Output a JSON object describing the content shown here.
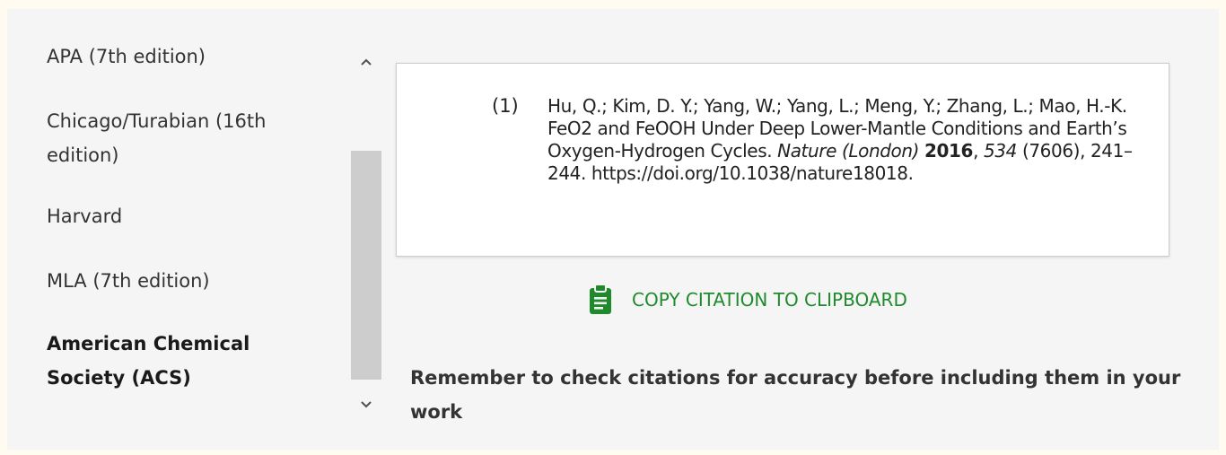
{
  "styles": {
    "items": [
      {
        "label": "APA (7th edition)",
        "selected": false
      },
      {
        "label": "Chicago/Turabian (16th edition)",
        "selected": false
      },
      {
        "label": "Harvard",
        "selected": false
      },
      {
        "label": "MLA (7th edition)",
        "selected": false
      },
      {
        "label": "American Chemical Society (ACS)",
        "selected": true
      }
    ]
  },
  "citation": {
    "number": "(1)",
    "authors": "Hu, Q.; Kim, D. Y.; Yang, W.; Yang, L.; Meng, Y.; Zhang, L.; Mao, H.-K.",
    "title": "FeO2 and FeOOH Under Deep Lower-Mantle Conditions and Earth’s Oxygen-Hydrogen Cycles.",
    "journal": "Nature (London)",
    "year": "2016",
    "volume": "534",
    "issue": "(7606)",
    "pages": "241–244.",
    "doi": "https://doi.org/10.1038/nature18018."
  },
  "copy_button": {
    "label": "COPY CITATION TO CLIPBOARD",
    "icon": "clipboard-icon",
    "color": "#1f8a2b"
  },
  "reminder": "Remember to check citations for accuracy before including them in your work",
  "scrollbar": {
    "up_icon": "chevron-up-icon",
    "down_icon": "chevron-down-icon"
  }
}
